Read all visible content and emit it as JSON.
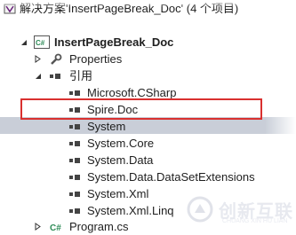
{
  "solution": {
    "label": "解决方案'InsertPageBreak_Doc' (4 个项目)"
  },
  "project": {
    "label": "InsertPageBreak_Doc",
    "icon": "csharp-project-icon"
  },
  "properties": {
    "label": "Properties",
    "icon": "wrench-icon"
  },
  "references": {
    "label": "引用",
    "icon": "references-icon",
    "items": [
      {
        "label": "Microsoft.CSharp"
      },
      {
        "label": "Spire.Doc"
      },
      {
        "label": "System"
      },
      {
        "label": "System.Core"
      },
      {
        "label": "System.Data"
      },
      {
        "label": "System.Data.DataSetExtensions"
      },
      {
        "label": "System.Xml"
      },
      {
        "label": "System.Xml.Linq"
      }
    ]
  },
  "program_file": {
    "label": "Program.cs",
    "icon": "csharp-file-icon"
  },
  "watermark": {
    "text": "创新互联",
    "sub": "CHUANG XIN HU LIAN"
  },
  "colors": {
    "highlight": "#d9302f",
    "selection": "#c9ced8",
    "csharp": "#2e8b57"
  }
}
